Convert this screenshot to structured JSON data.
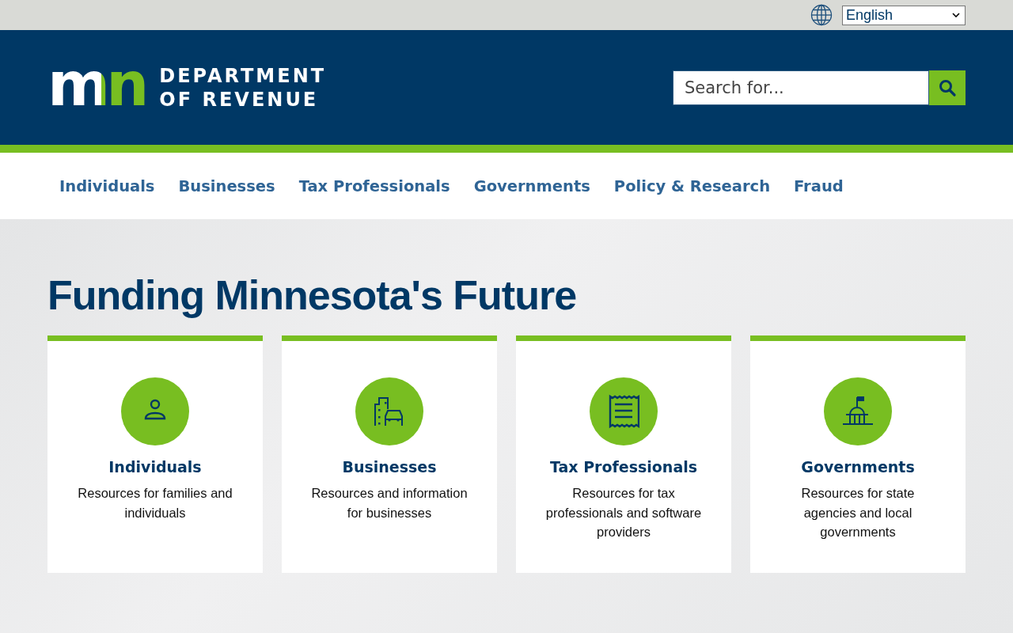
{
  "language_select": {
    "value": "English"
  },
  "header": {
    "logo_mark": "mn",
    "logo_line_1": "DEPARTMENT",
    "logo_line_2": "OF REVENUE",
    "search": {
      "placeholder": "Search for..."
    }
  },
  "nav": [
    "Individuals",
    "Businesses",
    "Tax Professionals",
    "Governments",
    "Policy & Research",
    "Fraud"
  ],
  "hero": {
    "title": "Funding Minnesota's Future"
  },
  "cards": [
    {
      "kind": "person",
      "title": "Individuals",
      "text": "Resources for families and individuals"
    },
    {
      "kind": "business",
      "title": "Businesses",
      "text": "Resources and information for businesses"
    },
    {
      "kind": "receipt",
      "title": "Tax Professionals",
      "text": "Resources for tax professionals and software providers"
    },
    {
      "kind": "capitol",
      "title": "Governments",
      "text": "Resources for state agencies and local governments"
    }
  ]
}
